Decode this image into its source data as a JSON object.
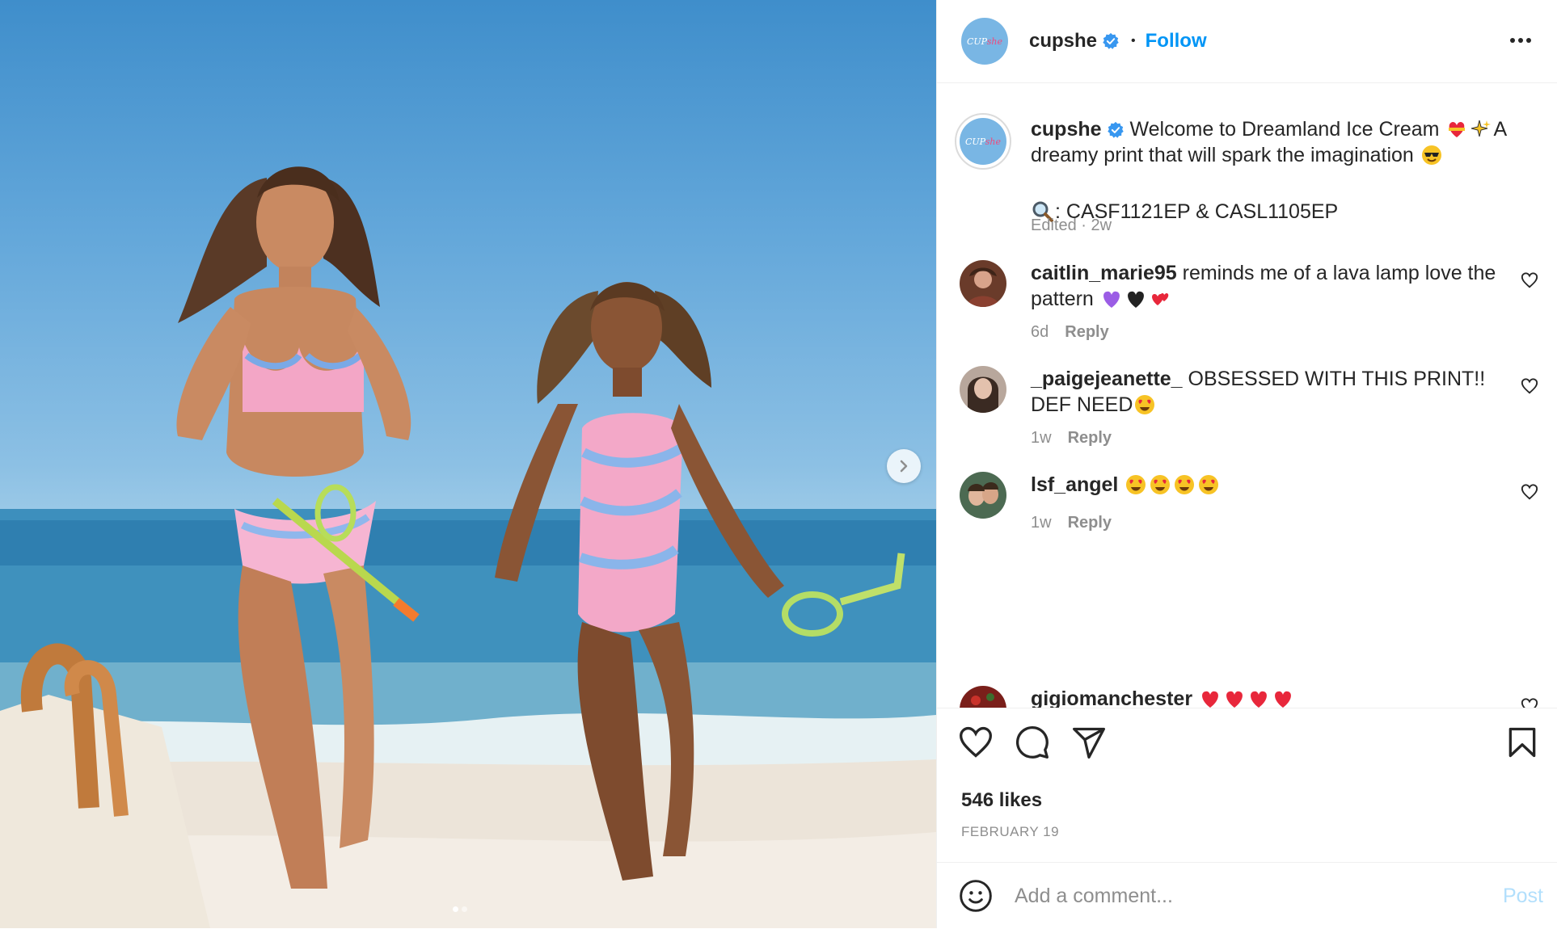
{
  "header": {
    "username": "cupshe",
    "separator": "•",
    "follow_label": "Follow"
  },
  "avatar_logo": {
    "prefix": "CUP",
    "suffix": "she"
  },
  "caption": {
    "username": "cupshe",
    "text_part1": "Welcome to Dreamland Ice Cream",
    "text_part2": "A dreamy print that will spark the imagination",
    "product_codes": ": CASF1121EP & CASL1105EP",
    "meta": "Edited · 2w"
  },
  "comments": [
    {
      "username": "caitlin_marie95",
      "text": "reminds me of a lava lamp love the pattern",
      "time": "6d",
      "reply_label": "Reply"
    },
    {
      "username": "_paigejeanette_",
      "text": "OBSESSED WITH THIS PRINT!! DEF NEED",
      "time": "1w",
      "reply_label": "Reply"
    },
    {
      "username": "lsf_angel",
      "text": "",
      "time": "1w",
      "reply_label": "Reply"
    },
    {
      "username": "gigiomanchester",
      "text": ""
    }
  ],
  "engagement": {
    "likes": "546 likes",
    "date": "FEBRUARY 19"
  },
  "add_comment": {
    "placeholder": "Add a comment...",
    "post_label": "Post"
  },
  "carousel": {
    "slide_count": 2,
    "active_slide": 1
  },
  "colors": {
    "accent_blue": "#0095f6",
    "post_disabled": "#b2dffc",
    "muted_text": "#8e8e8e",
    "verified_blue": "#3897f0"
  },
  "icons": [
    "more-options-icon",
    "verified-icon",
    "chevron-right-icon",
    "heart-icon",
    "comment-icon",
    "share-icon",
    "bookmark-icon",
    "emoji-icon",
    "search-emoji-icon"
  ]
}
